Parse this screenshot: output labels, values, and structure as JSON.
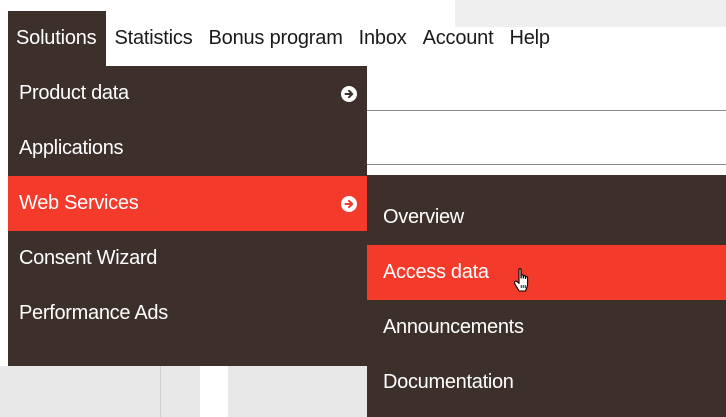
{
  "topnav": {
    "items": [
      {
        "label": "Solutions",
        "active": true
      },
      {
        "label": "Statistics",
        "active": false
      },
      {
        "label": "Bonus program",
        "active": false
      },
      {
        "label": "Inbox",
        "active": false
      },
      {
        "label": "Account",
        "active": false
      },
      {
        "label": "Help",
        "active": false
      }
    ]
  },
  "solutions_menu": {
    "items": [
      {
        "label": "Product data",
        "has_submenu": true,
        "active": false
      },
      {
        "label": "Applications",
        "has_submenu": false,
        "active": false
      },
      {
        "label": "Web Services",
        "has_submenu": true,
        "active": true
      },
      {
        "label": "Consent Wizard",
        "has_submenu": false,
        "active": false
      },
      {
        "label": "Performance Ads",
        "has_submenu": false,
        "active": false
      }
    ]
  },
  "web_services_submenu": {
    "items": [
      {
        "label": "Overview",
        "active": false
      },
      {
        "label": "Access data",
        "active": true
      },
      {
        "label": "Announcements",
        "active": false
      },
      {
        "label": "Documentation",
        "active": false
      }
    ]
  },
  "colors": {
    "menu_bg": "#3d302b",
    "accent": "#f43b2b",
    "text_light": "#ffffff"
  },
  "icons": {
    "submenu_arrow": "arrow-right-circle-icon",
    "cursor": "hand-pointer-icon"
  }
}
